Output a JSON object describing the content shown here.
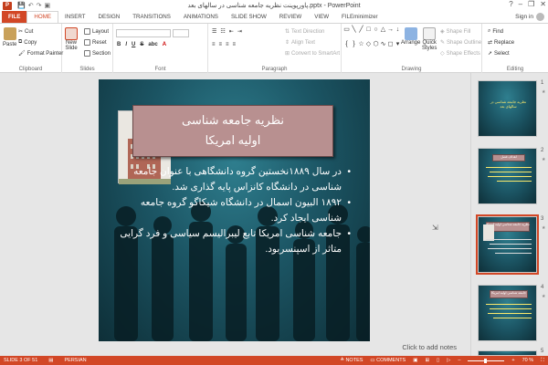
{
  "app": {
    "title": "پاورپوینت نظریه جامعه شناسی در سالهای بعد.pptx - PowerPoint",
    "app_icon": "P",
    "window_controls": [
      "?",
      "–",
      "❐",
      "✕"
    ]
  },
  "quick_access": [
    "save-icon",
    "undo-icon",
    "redo-icon",
    "slideshow-icon"
  ],
  "tabs": [
    "FILE",
    "HOME",
    "INSERT",
    "DESIGN",
    "TRANSITIONS",
    "ANIMATIONS",
    "SLIDE SHOW",
    "REVIEW",
    "VIEW",
    "FILEminimizer"
  ],
  "active_tab": "HOME",
  "account": {
    "sign_in": "Sign in"
  },
  "ribbon": {
    "clipboard": {
      "paste": "Paste",
      "cut": "Cut",
      "copy": "Copy",
      "format_painter": "Format Painter",
      "label": "Clipboard"
    },
    "slides": {
      "new_slide": "New",
      "new_slide2": "Slide",
      "layout": "Layout",
      "reset": "Reset",
      "section": "Section",
      "label": "Slides"
    },
    "font": {
      "bold": "B",
      "italic": "I",
      "underline": "U",
      "strike": "S",
      "abc": "abc",
      "label": "Font"
    },
    "paragraph": {
      "text_direction": "Text Direction",
      "align_text": "Align Text",
      "convert_smartart": "Convert to SmartArt",
      "label": "Paragraph"
    },
    "drawing": {
      "arrange": "Arrange",
      "quick_styles": "Quick",
      "quick_styles2": "Styles",
      "shape_fill": "Shape Fill",
      "shape_outline": "Shape Outline",
      "shape_effects": "Shape Effects",
      "label": "Drawing"
    },
    "editing": {
      "find": "Find",
      "replace": "Replace",
      "select": "Select",
      "label": "Editing"
    }
  },
  "slide": {
    "title_line1": "نظریه جامعه شناسی",
    "title_line2": "اولیه امریکا",
    "bullets": [
      "در سال ۱۸۸۹نخستین گروه دانشگاهی با عنوان جامعه شناسی در دانشگاه کانزاس پایه گذاری شد.",
      "۱۸۹۲ البیون اسمال در دانشگاه شیکاگو گروه جامعه شناسی ایجاد کرد.",
      "جامعه شناسی امریکا تابع لیبرالیسم سیاسی و فرد گرایی متاثر از اسپنسربود."
    ]
  },
  "notes_placeholder": "Click to add notes",
  "thumbnails": [
    {
      "number": "1",
      "title": "نظریه جامعه شناسی در سالهای بعد"
    },
    {
      "number": "2",
      "title": "اهداف فصل"
    },
    {
      "number": "3",
      "title": "نظریه جامعه شناسی اولیه امریکا"
    },
    {
      "number": "4",
      "title": "جامعه شناسی اولیه امریکا"
    },
    {
      "number": "5",
      "title": ""
    }
  ],
  "selected_slide": 3,
  "status": {
    "slide_info": "SLIDE 3 OF 51",
    "language": "PERSIAN",
    "notes": "NOTES",
    "comments": "COMMENTS",
    "zoom": "70 %"
  },
  "colors": {
    "accent": "#d24726",
    "slide_bg": "#1c5665",
    "title_box": "#b89090",
    "text_highlight": "#fbe96b"
  }
}
